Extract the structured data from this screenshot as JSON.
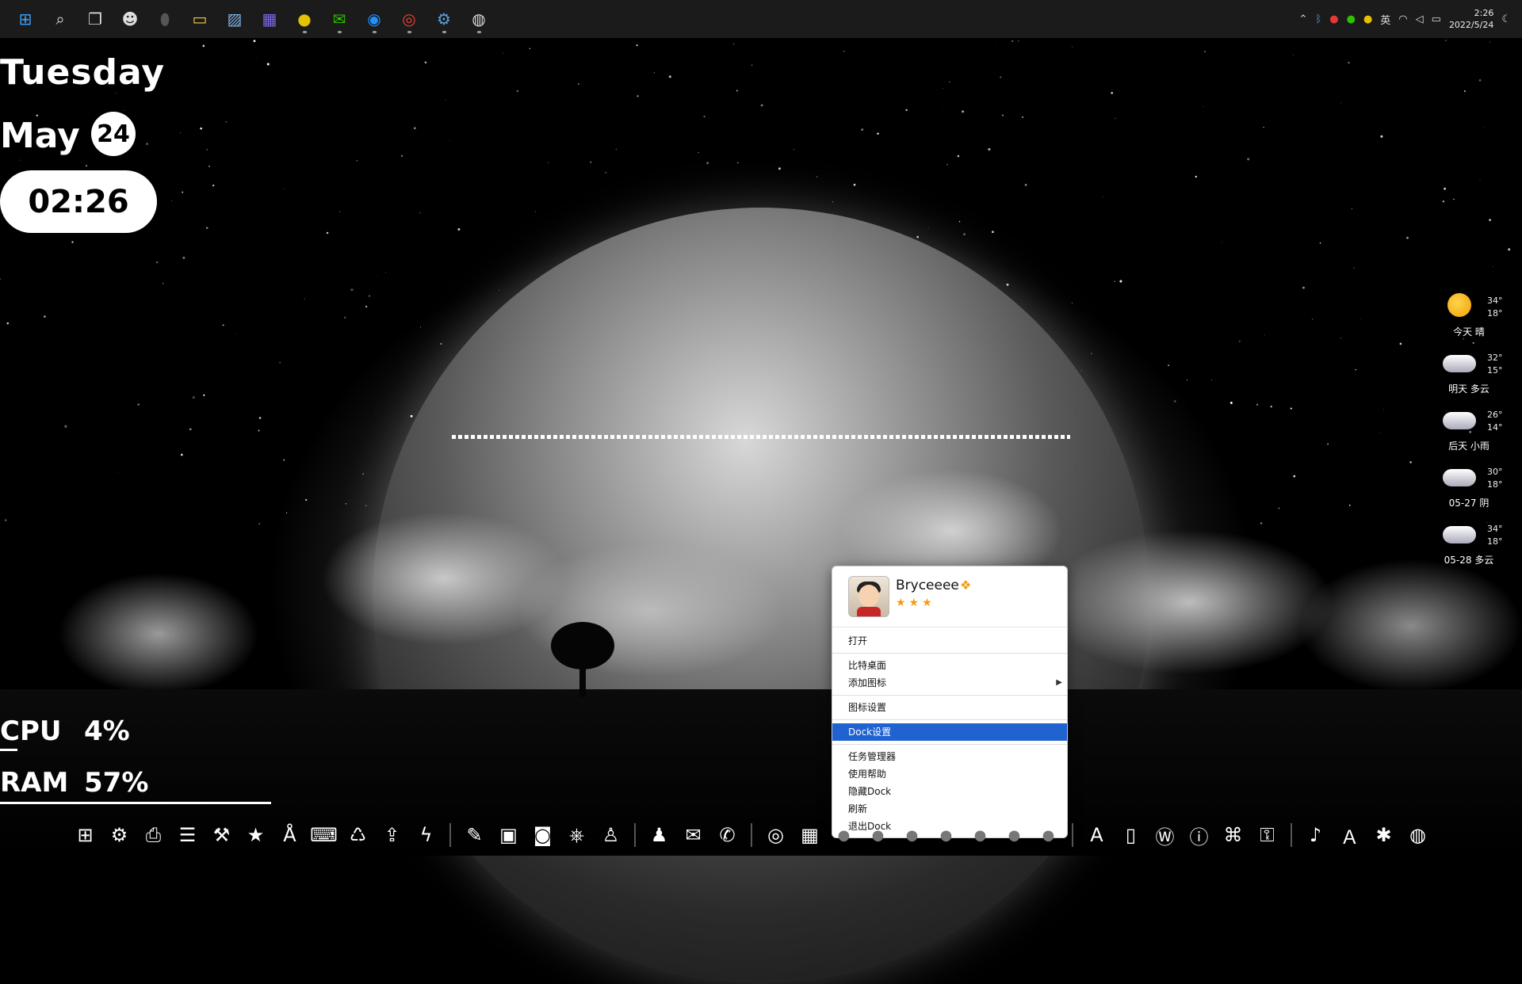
{
  "taskbar": {
    "icons": [
      {
        "name": "windows-start-icon",
        "glyph": "⊞",
        "color": "#3aa0ff"
      },
      {
        "name": "search-icon",
        "glyph": "⌕",
        "color": "#dddddd"
      },
      {
        "name": "task-view-icon",
        "glyph": "❐",
        "color": "#dddddd"
      },
      {
        "name": "alien-icon",
        "glyph": "☻",
        "color": "#dddddd"
      },
      {
        "name": "shield-icon",
        "glyph": "⬮",
        "color": "#555555"
      },
      {
        "name": "file-explorer-icon",
        "glyph": "▭",
        "color": "#f7c948"
      },
      {
        "name": "photos-icon",
        "glyph": "▨",
        "color": "#7fb2e5"
      },
      {
        "name": "calendar-app-icon",
        "glyph": "▦",
        "color": "#7b68ee"
      },
      {
        "name": "tencent-app-icon",
        "glyph": "●",
        "color": "#e5c100"
      },
      {
        "name": "wechat-icon",
        "glyph": "✉",
        "color": "#2dc100"
      },
      {
        "name": "browser-icon",
        "glyph": "◉",
        "color": "#1e90ff"
      },
      {
        "name": "chrome-icon",
        "glyph": "◎",
        "color": "#e94235"
      },
      {
        "name": "settings-icon",
        "glyph": "⚙",
        "color": "#5aa0e0"
      },
      {
        "name": "steam-icon",
        "glyph": "◍",
        "color": "#dddddd"
      }
    ],
    "tray": {
      "items": [
        "chevron-up-icon",
        "bluetooth-icon",
        "app-tray-icon",
        "wechat-tray-icon",
        "tencent-tray-icon"
      ],
      "ime": "英",
      "time": "2:26",
      "date": "2022/5/24"
    }
  },
  "widgets": {
    "day": "Tuesday",
    "month": "May",
    "date": "24",
    "time": "02:26",
    "cpu_label": "CPU",
    "cpu_value": "4%",
    "ram_label": "RAM",
    "ram_value": "57%",
    "cpu_usage_percent": 4,
    "ram_usage_percent": 57
  },
  "weather": [
    {
      "label": "今天 晴",
      "high": "34°",
      "low": "18°",
      "icon": "sun"
    },
    {
      "label": "明天 多云",
      "high": "32°",
      "low": "15°",
      "icon": "cloud"
    },
    {
      "label": "后天 小雨",
      "high": "26°",
      "low": "14°",
      "icon": "cloud"
    },
    {
      "label": "05-27 阴",
      "high": "30°",
      "low": "18°",
      "icon": "cloud"
    },
    {
      "label": "05-28 多云",
      "high": "34°",
      "low": "18°",
      "icon": "cloud"
    }
  ],
  "menu": {
    "username": "Bryceeee",
    "vip_glyph": "❖",
    "stars": "★★★",
    "items": [
      {
        "label": "打开"
      },
      {
        "label": "比特桌面"
      },
      {
        "label": "添加图标",
        "submenu_arrow": "▶"
      },
      {
        "label": "图标设置"
      },
      {
        "label": "Dock设置",
        "selected": true
      },
      {
        "label": "任务管理器"
      },
      {
        "label": "使用帮助"
      },
      {
        "label": "隐藏Dock"
      },
      {
        "label": "刷新"
      },
      {
        "label": "退出Dock"
      }
    ]
  },
  "dock": {
    "groups": [
      [
        "windows-icon",
        "gear-icon",
        "monitor-download-icon",
        "list-icon",
        "tools-icon",
        "star-folder-icon",
        "app-store-icon",
        "terminal-icon",
        "trash-icon",
        "upload-icon",
        "lightning-icon"
      ],
      [
        "brush-icon",
        "tv-icon",
        "camera-icon",
        "gamepad-icon",
        "robot-icon"
      ],
      [
        "qq-icon",
        "wechat-icon",
        "chat-icon"
      ],
      [
        "chrome-icon",
        "calendar-icon",
        "circle-icon",
        "circle-icon",
        "circle-icon",
        "circle-icon",
        "circle-icon",
        "circle-icon",
        "circle-icon"
      ],
      [
        "adobe-icon",
        "office-icon",
        "wps-icon",
        "info-icon",
        "cmd-icon",
        "toolbox-icon"
      ],
      [
        "music-icon",
        "translate-icon",
        "bug-icon",
        "steam-icon"
      ]
    ],
    "glyphs": {
      "windows-icon": "⊞",
      "gear-icon": "⚙",
      "monitor-download-icon": "⎙",
      "list-icon": "☰",
      "tools-icon": "⚒",
      "star-folder-icon": "★",
      "app-store-icon": "Å",
      "terminal-icon": "⌨",
      "trash-icon": "♺",
      "upload-icon": "⇪",
      "lightning-icon": "ϟ",
      "brush-icon": "✎",
      "tv-icon": "▣",
      "camera-icon": "◙",
      "gamepad-icon": "⎈",
      "robot-icon": "♙",
      "qq-icon": "♟",
      "wechat-icon": "✉",
      "chat-icon": "✆",
      "chrome-icon": "◎",
      "calendar-icon": "▦",
      "circle-icon": "●",
      "adobe-icon": "A",
      "office-icon": "▯",
      "wps-icon": "Ⓦ",
      "info-icon": "ⓘ",
      "cmd-icon": "⌘",
      "toolbox-icon": "⚿",
      "music-icon": "♪",
      "translate-icon": "Ａ",
      "bug-icon": "✱",
      "steam-icon": "◍"
    }
  }
}
